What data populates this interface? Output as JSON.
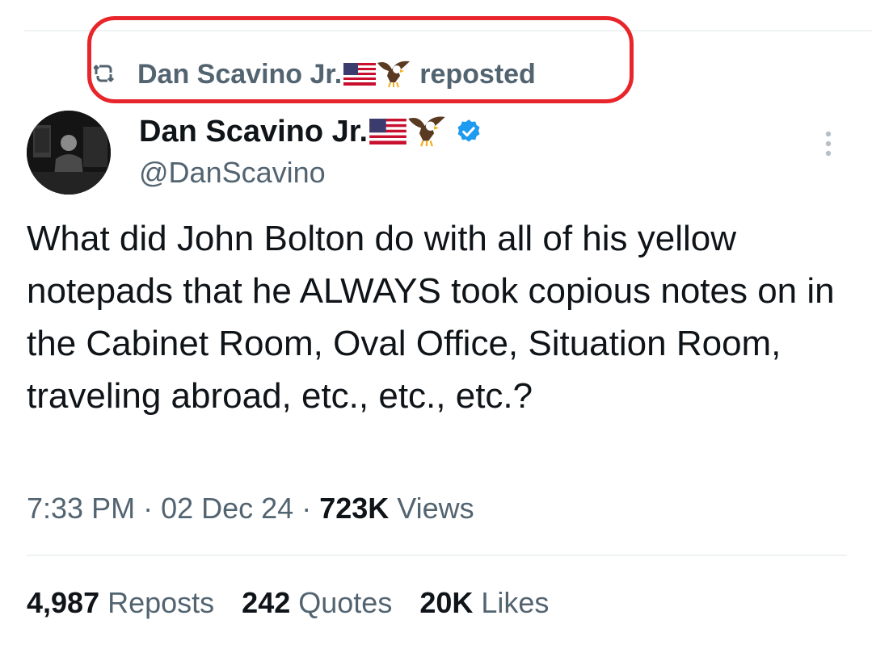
{
  "repost_banner": {
    "name": "Dan Scavino Jr.",
    "suffix": "reposted"
  },
  "author": {
    "display_name": "Dan Scavino Jr.",
    "handle": "@DanScavino",
    "verified": true
  },
  "tweet": {
    "text": "What did John Bolton do with all of his yellow notepads that he ALWAYS took copious notes on in the Cabinet Room, Oval Office, Situation Room, traveling abroad, etc., etc., etc.?",
    "time": "7:33 PM",
    "date": "02 Dec 24",
    "views_count": "723K",
    "views_label": "Views"
  },
  "stats": {
    "reposts": {
      "count": "4,987",
      "label": "Reposts"
    },
    "quotes": {
      "count": "242",
      "label": "Quotes"
    },
    "likes": {
      "count": "20K",
      "label": "Likes"
    }
  },
  "colors": {
    "highlight": "#e8252a",
    "verified": "#1d9bf0",
    "secondary_text": "#536471",
    "primary_text": "#0f1419"
  },
  "icons": {
    "repost": "repost-icon",
    "flag": "us-flag-icon",
    "eagle": "eagle-icon",
    "verified": "verified-badge-icon",
    "more": "more-options-icon"
  }
}
